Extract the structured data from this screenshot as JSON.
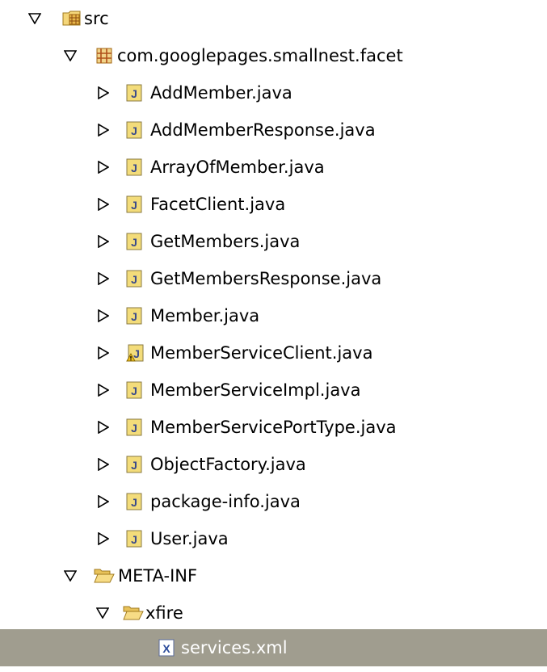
{
  "tree": {
    "src": {
      "label": "src",
      "icon": "source-folder-icon",
      "expanded": true
    },
    "package": {
      "label": "com.googlepages.smallnest.facet",
      "icon": "package-icon",
      "expanded": true
    },
    "files": [
      {
        "label": "AddMember.java",
        "icon": "java-file-icon",
        "warning": false
      },
      {
        "label": "AddMemberResponse.java",
        "icon": "java-file-icon",
        "warning": false
      },
      {
        "label": "ArrayOfMember.java",
        "icon": "java-file-icon",
        "warning": false
      },
      {
        "label": "FacetClient.java",
        "icon": "java-file-icon",
        "warning": false
      },
      {
        "label": "GetMembers.java",
        "icon": "java-file-icon",
        "warning": false
      },
      {
        "label": "GetMembersResponse.java",
        "icon": "java-file-icon",
        "warning": false
      },
      {
        "label": "Member.java",
        "icon": "java-file-icon",
        "warning": false
      },
      {
        "label": "MemberServiceClient.java",
        "icon": "java-file-warning-icon",
        "warning": true
      },
      {
        "label": "MemberServiceImpl.java",
        "icon": "java-file-icon",
        "warning": false
      },
      {
        "label": "MemberServicePortType.java",
        "icon": "java-file-icon",
        "warning": false
      },
      {
        "label": "ObjectFactory.java",
        "icon": "java-file-icon",
        "warning": false
      },
      {
        "label": "package-info.java",
        "icon": "java-file-icon",
        "warning": false
      },
      {
        "label": "User.java",
        "icon": "java-file-icon",
        "warning": false
      }
    ],
    "meta_inf": {
      "label": "META-INF",
      "icon": "folder-open-icon",
      "expanded": true
    },
    "xfire": {
      "label": "xfire",
      "icon": "folder-open-icon",
      "expanded": true
    },
    "services": {
      "label": "services.xml",
      "icon": "xml-file-icon",
      "selected": true
    }
  },
  "colors": {
    "selection_background": "#a09d8f",
    "selection_text": "#ffffff",
    "java_icon_fill": "#e8c23c",
    "folder_fill": "#f4d67a",
    "package_fill": "#c89b3a"
  }
}
